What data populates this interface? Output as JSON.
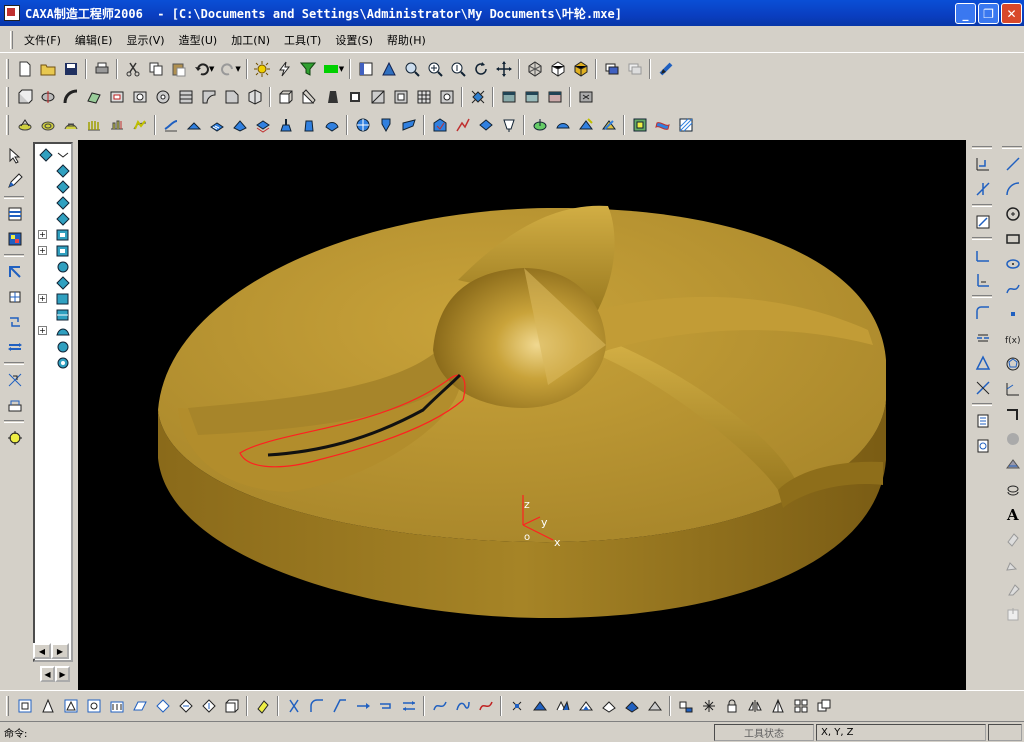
{
  "window": {
    "title": "CAXA制造工程师2006  - [C:\\Documents and Settings\\Administrator\\My Documents\\叶轮.mxe]",
    "buttons": [
      "minimize",
      "restore",
      "close"
    ]
  },
  "menu": {
    "items": [
      {
        "label": "文件(F)"
      },
      {
        "label": "编辑(E)"
      },
      {
        "label": "显示(V)"
      },
      {
        "label": "造型(U)"
      },
      {
        "label": "加工(N)"
      },
      {
        "label": "工具(T)"
      },
      {
        "label": "设置(S)"
      },
      {
        "label": "帮助(H)"
      }
    ]
  },
  "colors": {
    "titlebar": "#0a3ec0",
    "chrome": "#d4d0c8",
    "viewport_bg": "#000000",
    "part_gold": "#b8922e",
    "selection_outline": "#ff2020",
    "toolpath": "#111111"
  },
  "viewport": {
    "axis_labels": {
      "z": "z",
      "y": "y",
      "x": "x",
      "origin": "o"
    }
  },
  "tree": {
    "nodes": [
      "model-node",
      "plane-node",
      "plane-node",
      "plane-node",
      "plane-node",
      "plane-node",
      "feature-node",
      "feature-node",
      "feature-node",
      "feature-node",
      "feature-node",
      "feature-node",
      "feature-node",
      "feature-node",
      "feature-node"
    ]
  },
  "status": {
    "command_label": "命令:",
    "tool_state": "工具状态",
    "coords": "X, Y, Z"
  }
}
